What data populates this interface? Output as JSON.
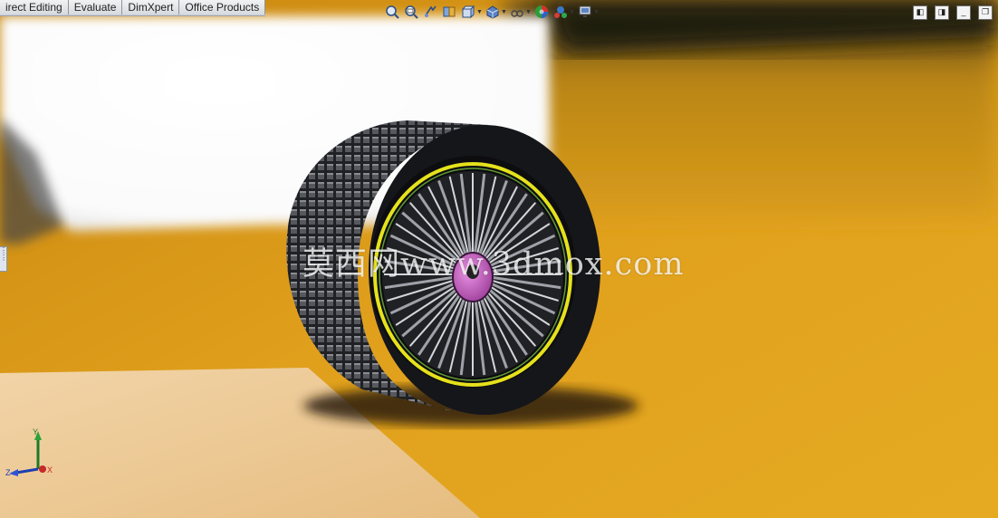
{
  "command_manager": {
    "tabs": [
      {
        "label": "irect Editing"
      },
      {
        "label": "Evaluate"
      },
      {
        "label": "DimXpert"
      },
      {
        "label": "Office Products"
      }
    ]
  },
  "heads_up_toolbar": [
    {
      "icon": "zoom-to-fit-icon"
    },
    {
      "icon": "zoom-to-area-icon"
    },
    {
      "icon": "previous-view-icon"
    },
    {
      "icon": "section-view-icon"
    },
    {
      "icon": "view-orientation-icon",
      "dropdown": true
    },
    {
      "icon": "display-style-icon",
      "dropdown": true
    },
    {
      "icon": "hide-show-items-icon",
      "dropdown": true
    },
    {
      "icon": "edit-appearance-icon"
    },
    {
      "icon": "apply-scene-icon",
      "dropdown": true
    },
    {
      "icon": "view-settings-icon",
      "dropdown": true
    }
  ],
  "window_controls": [
    "tile-left-icon",
    "tile-right-icon",
    "minimize-icon",
    "restore-icon"
  ],
  "watermark": {
    "text": "莫西网www.3dmox.com"
  },
  "triad": {
    "x_label": "X",
    "y_label": "Y",
    "z_label": "Z"
  },
  "colors": {
    "floor": "#d99a16",
    "backdrop": "#ffffff",
    "tire": "#1b1c1e",
    "rim_ring": "#e5e21c",
    "hub": "#c85ac4",
    "ground_plate": "#e9c28a"
  }
}
